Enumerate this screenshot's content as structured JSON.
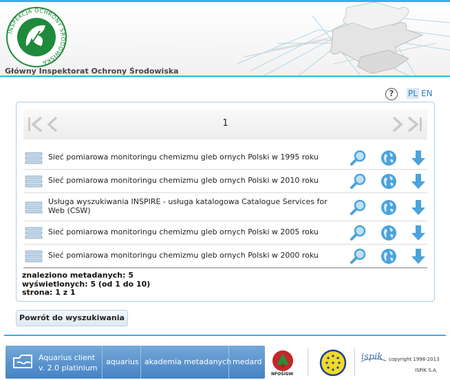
{
  "header": {
    "organization": "Główny Inspektorat Ochrony Środowiska",
    "logo_text": "INSPEKCJA OCHRONY ŚRODOWISKA"
  },
  "toolbar": {
    "help_label": "?",
    "lang_pl": "PL",
    "lang_en": "EN"
  },
  "pager": {
    "current_page": "1"
  },
  "results": [
    {
      "title": "Sieć pomiarowa monitoringu chemizmu gleb ornych Polski w 1995 roku"
    },
    {
      "title": "Sieć pomiarowa monitoringu chemizmu gleb ornych Polski w 2010 roku"
    },
    {
      "title": "Usługa wyszukiwania INSPIRE - usługa katalogowa Catalogue Services for Web (CSW)"
    },
    {
      "title": "Sieć pomiarowa monitoringu chemizmu gleb ornych Polski w 2005 roku"
    },
    {
      "title": "Sieć pomiarowa monitoringu chemizmu gleb ornych Polski w 2000 roku"
    }
  ],
  "stats": {
    "found": "znaleziono metadanych: 5",
    "shown": "wyświetlonych: 5 (od 1 do 10)",
    "page": "strona: 1 z 1"
  },
  "back_button": "Powrót do wyszukiwania",
  "footer": {
    "app_name": "Aquarius client",
    "app_version": "v. 2.0 platinium",
    "links": [
      "aquarius",
      "akademia metadanych",
      "medard"
    ],
    "nfos_label": "NFOŚiGW",
    "ispik_logo": "ispik",
    "copyright": "copyright 1998-2013",
    "company": "ISPiK S.A."
  },
  "colors": {
    "accent": "#2fb4e6",
    "footer_blue": "#4682c4",
    "icon_blue": "#4aa3dc"
  }
}
